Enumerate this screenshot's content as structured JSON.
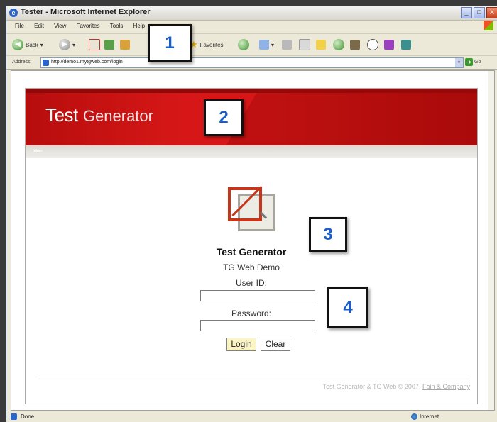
{
  "window": {
    "title": "Tester - Microsoft Internet Explorer",
    "min": "_",
    "max": "□",
    "close": "X"
  },
  "menu": [
    "File",
    "Edit",
    "View",
    "Favorites",
    "Tools",
    "Help"
  ],
  "toolbar": {
    "back": "Back",
    "favorites": "Favorites"
  },
  "address": {
    "label": "Address",
    "url": "http://demo1.mytgweb.com/login",
    "go": "Go"
  },
  "banner": {
    "brand_bold": "Test",
    "brand_light": "Generator",
    "chevrons": "»»···"
  },
  "login": {
    "title": "Test Generator",
    "subtitle": "TG Web Demo",
    "user_label": "User ID:",
    "password_label": "Password:",
    "login_button": "Login",
    "clear_button": "Clear"
  },
  "footer": {
    "text": "Test Generator & TG Web © 2007,",
    "link": "Fain & Company"
  },
  "status": {
    "left": "Done",
    "zone": "Internet"
  },
  "callouts": [
    "1",
    "2",
    "3",
    "4"
  ],
  "colors": {
    "banner_red": "#d71717",
    "callout_text": "#1a5dc8",
    "login_button_bg": "#fbf4c3"
  }
}
